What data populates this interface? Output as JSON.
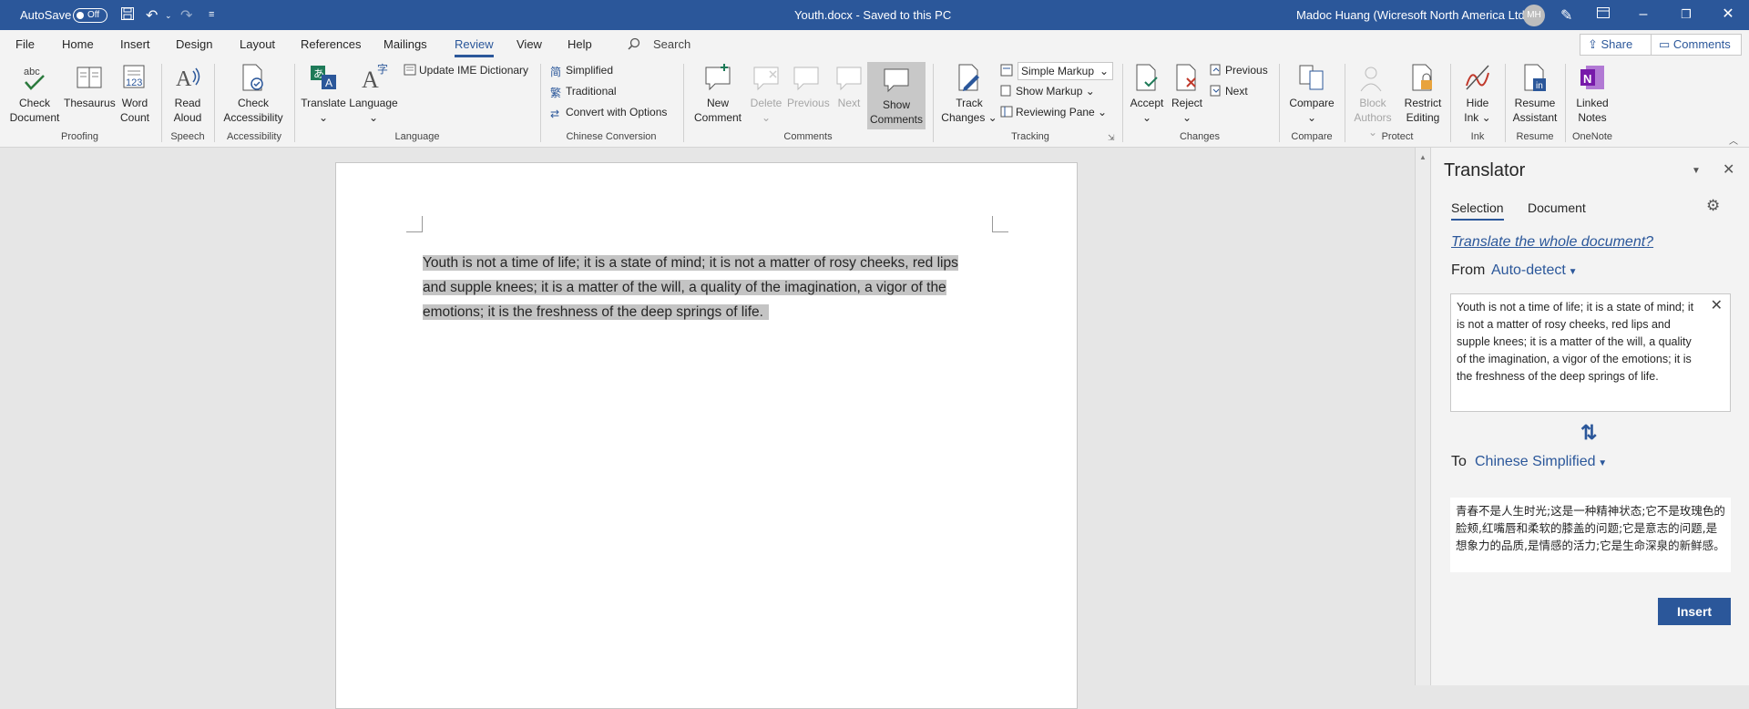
{
  "titlebar": {
    "autosave_label": "AutoSave",
    "autosave_state": "Off",
    "doc_title": "Youth.docx  -  Saved to this PC",
    "user": "Madoc Huang (Wicresoft North America Ltd)",
    "initials": "MH"
  },
  "tabs": [
    "File",
    "Home",
    "Insert",
    "Design",
    "Layout",
    "References",
    "Mailings",
    "Review",
    "View",
    "Help"
  ],
  "search_label": "Search",
  "share_label": "Share",
  "comments_label": "Comments",
  "ribbon": {
    "proofing": {
      "label": "Proofing",
      "check_document": [
        "Check",
        "Document"
      ],
      "thesaurus": "Thesaurus",
      "word_count": [
        "Word",
        "Count"
      ]
    },
    "speech": {
      "label": "Speech",
      "read_aloud": [
        "Read",
        "Aloud"
      ]
    },
    "accessibility": {
      "label": "Accessibility",
      "check_accessibility": [
        "Check",
        "Accessibility"
      ]
    },
    "language": {
      "label": "Language",
      "translate": "Translate",
      "language": "Language",
      "update_ime": "Update IME Dictionary"
    },
    "chinese_conversion": {
      "label": "Chinese Conversion",
      "simplified": "Simplified",
      "traditional": "Traditional",
      "convert_options": "Convert with Options"
    },
    "comments": {
      "label": "Comments",
      "new_comment": [
        "New",
        "Comment"
      ],
      "delete": "Delete",
      "previous": "Previous",
      "next": "Next",
      "show_comments": [
        "Show",
        "Comments"
      ]
    },
    "tracking": {
      "label": "Tracking",
      "track_changes": [
        "Track",
        "Changes"
      ],
      "markup_select": "Simple Markup",
      "show_markup": "Show Markup",
      "reviewing_pane": "Reviewing Pane"
    },
    "changes": {
      "label": "Changes",
      "accept": "Accept",
      "reject": "Reject",
      "previous": "Previous",
      "next": "Next"
    },
    "compare": {
      "label": "Compare",
      "compare": "Compare"
    },
    "protect": {
      "label": "Protect",
      "block_authors": [
        "Block",
        "Authors"
      ],
      "restrict_editing": [
        "Restrict",
        "Editing"
      ]
    },
    "ink": {
      "label": "Ink",
      "hide_ink": [
        "Hide",
        "Ink"
      ]
    },
    "resume": {
      "label": "Resume",
      "resume_assistant": [
        "Resume",
        "Assistant"
      ]
    },
    "onenote": {
      "label": "OneNote",
      "linked_notes": [
        "Linked",
        "Notes"
      ]
    }
  },
  "document": {
    "paragraph_lines": [
      "Youth is not a time of life; it is a state of mind; it is not a matter of rosy cheeks, red lips",
      "and supple knees; it is a matter of the will, a quality of the imagination, a vigor of the",
      "emotions; it is the freshness of the deep springs of life."
    ]
  },
  "translator": {
    "title": "Translator",
    "tab_selection": "Selection",
    "tab_document": "Document",
    "translate_whole": "Translate the whole document?",
    "from_label": "From",
    "from_value": "Auto-detect",
    "source_text": "Youth is not a time of life; it is a state of mind; it is not a matter of rosy cheeks, red lips and supple knees; it is a matter of the will, a quality of the imagination, a vigor of the emotions; it is the freshness of the deep springs of life.",
    "to_label": "To",
    "to_value": "Chinese Simplified",
    "target_text": "青春不是人生时光;这是一种精神状态;它不是玫瑰色的脸颊,红嘴唇和柔软的膝盖的问题;它是意志的问题,是想象力的品质,是情感的活力;它是生命深泉的新鲜感。",
    "insert_label": "Insert"
  },
  "colors": {
    "brand": "#2b579a",
    "ribbon_bg": "#f3f3f3",
    "selection": "#c4c4c4"
  }
}
